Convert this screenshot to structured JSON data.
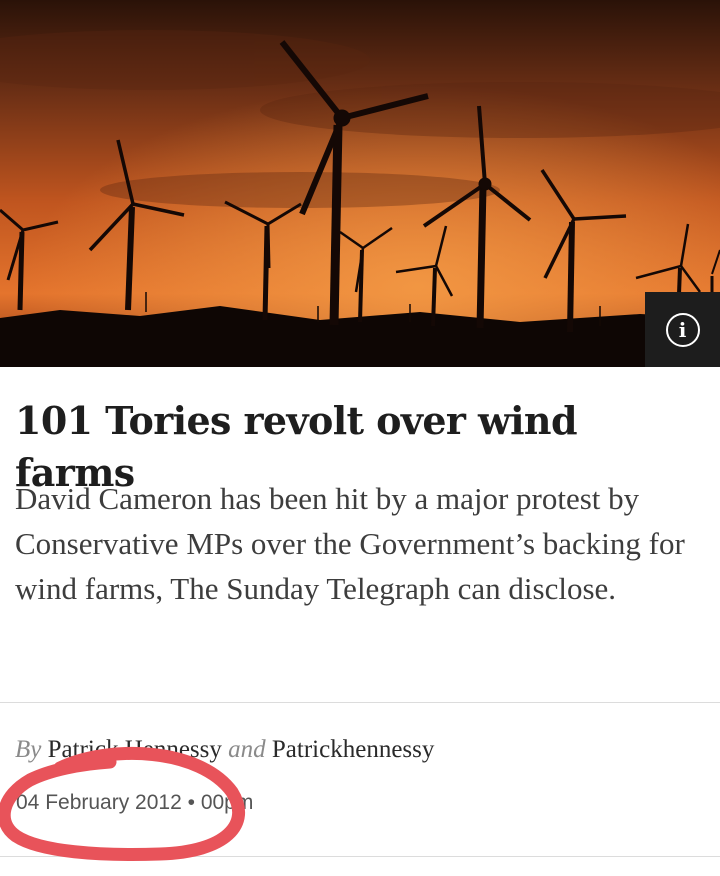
{
  "hero": {
    "info_icon": "info-icon",
    "info_glyph": "i"
  },
  "article": {
    "headline": "101 Tories revolt over wind farms",
    "standfirst": "David Cameron has been hit by a major protest by Conservative MPs over the Government’s backing for wind farms, The Sunday Telegraph can disclose.",
    "byline": {
      "by": "By",
      "author1": "Patrick Hennessy",
      "and": "and",
      "author2": "Patrickhennessy"
    },
    "date": "04 February 2012",
    "separator": "•",
    "time": "00pm"
  },
  "colors": {
    "scribble": "#e8535a",
    "info_bg": "#1d1d1d"
  }
}
